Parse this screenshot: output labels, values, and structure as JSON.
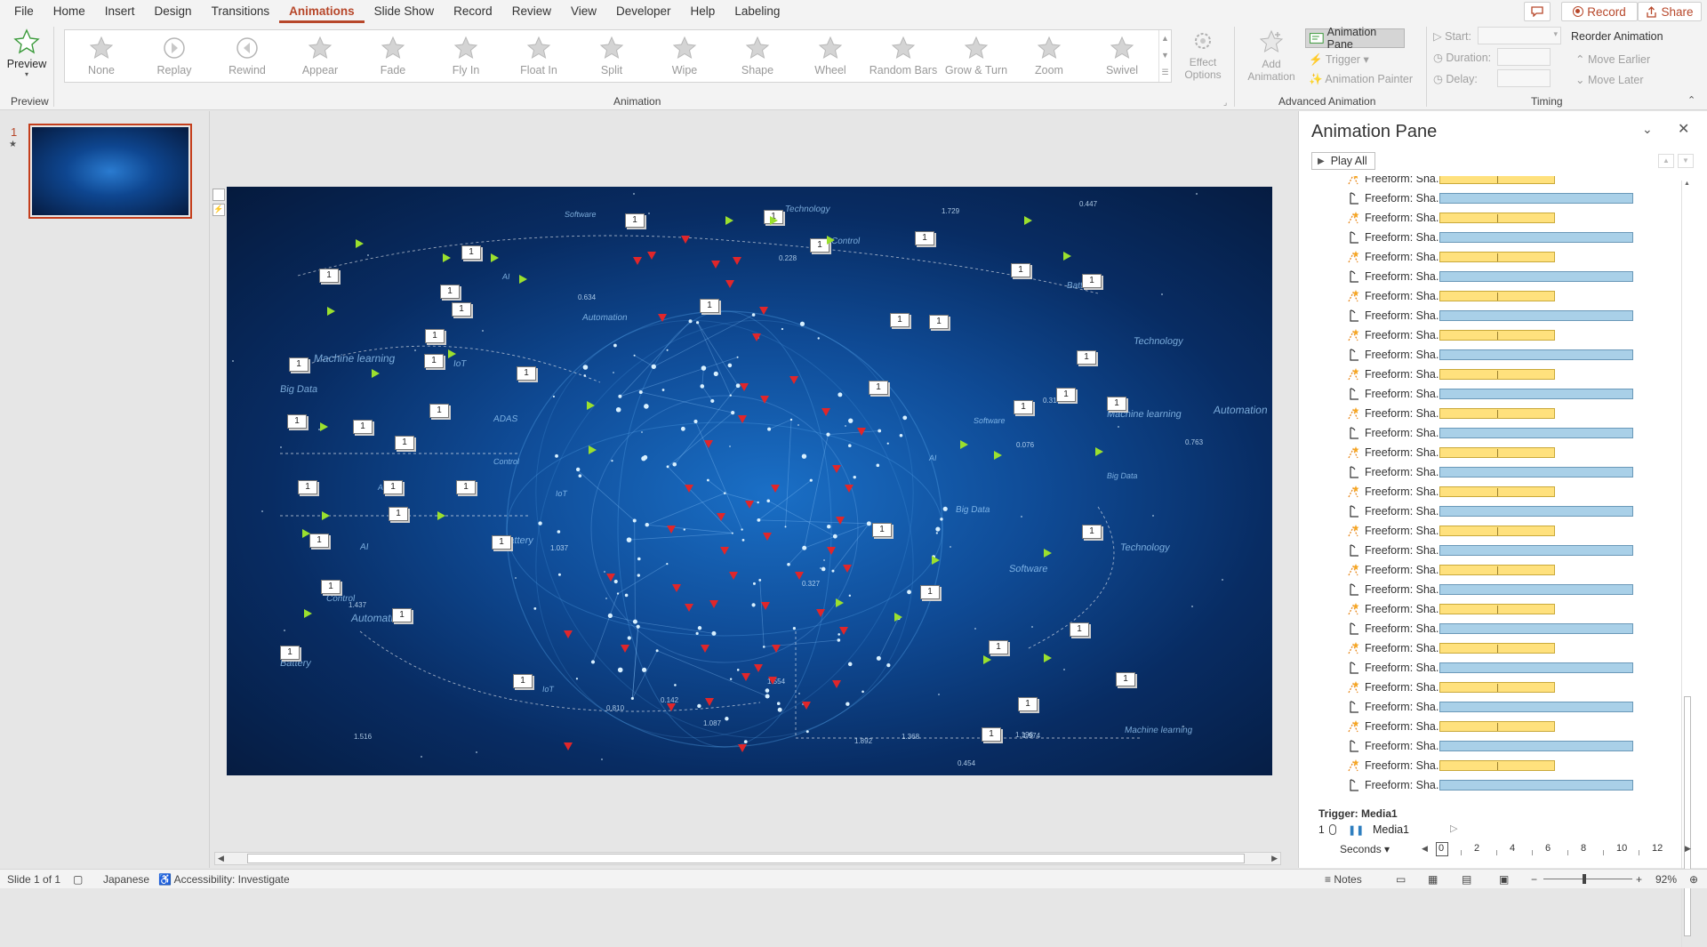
{
  "menu": {
    "items": [
      "File",
      "Home",
      "Insert",
      "Design",
      "Transitions",
      "Animations",
      "Slide Show",
      "Record",
      "Review",
      "View",
      "Developer",
      "Help",
      "Labeling"
    ],
    "active": "Animations",
    "record_label": "Record",
    "share_label": "Share"
  },
  "ribbon": {
    "preview_label": "Preview",
    "preview_group": "Preview",
    "effects": [
      "None",
      "Replay",
      "Rewind",
      "Appear",
      "Fade",
      "Fly In",
      "Float In",
      "Split",
      "Wipe",
      "Shape",
      "Wheel",
      "Random Bars",
      "Grow & Turn",
      "Zoom",
      "Swivel"
    ],
    "effect_options_label": "Effect Options",
    "animation_group": "Animation",
    "add_animation_label": "Add Animation",
    "animation_pane_label": "Animation Pane",
    "trigger_label": "Trigger",
    "animation_painter_label": "Animation Painter",
    "advanced_group": "Advanced Animation",
    "start_label": "Start:",
    "duration_label": "Duration:",
    "delay_label": "Delay:",
    "reorder_label": "Reorder Animation",
    "move_earlier_label": "Move Earlier",
    "move_later_label": "Move Later",
    "timing_group": "Timing"
  },
  "thumbnails": {
    "slide_number": "1",
    "star": "★"
  },
  "slide": {
    "words": [
      "Software",
      "Technology",
      "Control",
      "AI",
      "Machine learning",
      "Automation",
      "Big Data",
      "IoT",
      "ADAS",
      "Battery"
    ],
    "numbers": [
      "1.729",
      "0.142",
      "0.228",
      "1.892",
      "0.810",
      "1.437",
      "1.974",
      "0.634",
      "1.196",
      "0.454",
      "0.076",
      "1.037",
      "1.516",
      "0.310",
      "0.447",
      "1.368",
      "0.327",
      "1.554",
      "1.087",
      "0.763"
    ],
    "marker_label": "1"
  },
  "pane": {
    "title": "Animation Pane",
    "play_all_label": "Play All",
    "item_label": "Freeform: Sha...",
    "items": [
      "motion",
      "path",
      "motion",
      "path",
      "motion",
      "path",
      "motion",
      "path",
      "motion",
      "path",
      "motion",
      "path",
      "motion",
      "path",
      "motion",
      "path",
      "motion",
      "path",
      "motion",
      "path",
      "motion",
      "path",
      "motion",
      "path",
      "motion",
      "path",
      "motion",
      "path",
      "motion",
      "path",
      "motion",
      "path"
    ],
    "trigger_label": "Trigger: Media1",
    "media_index": "1",
    "media_label": "Media1",
    "seconds_label": "Seconds",
    "ticks": [
      "0",
      "2",
      "4",
      "6",
      "8",
      "10",
      "12"
    ],
    "bar_colors": {
      "motion": "#ffe17d",
      "path": "#a9d0e8"
    }
  },
  "status": {
    "slide_info": "Slide 1 of 1",
    "language": "Japanese",
    "accessibility": "Accessibility: Investigate",
    "notes_label": "Notes",
    "zoom": "92%"
  },
  "colors": {
    "accent": "#b7472a",
    "ribbon": "#f3f3f3",
    "canvas": "#e6e6e6"
  }
}
